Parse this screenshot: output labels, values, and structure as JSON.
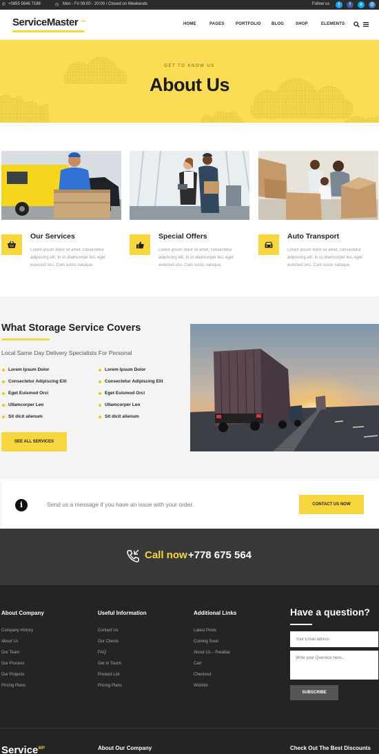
{
  "topbar": {
    "phone": "+0855 5646 7189",
    "hours": "Mon - Fri 08:00 - 20:00 / Closed on Weekends",
    "follow": "Follow us",
    "social": [
      {
        "icon": "twitter-icon",
        "glyph": "t",
        "color": "#1da1f2"
      },
      {
        "icon": "facebook-icon",
        "glyph": "f",
        "color": "#3b5998"
      },
      {
        "icon": "skype-icon",
        "glyph": "s",
        "color": "#00aff0"
      },
      {
        "icon": "email-icon",
        "glyph": "@",
        "color": "#2d7dd2"
      }
    ]
  },
  "header": {
    "logo": "ServiceMaster",
    "logo_sup": "WP",
    "nav": [
      "HOME",
      "PAGES",
      "PORTFOLIO",
      "BLOG",
      "SHOP",
      "ELEMENTS"
    ]
  },
  "hero": {
    "kicker": "GET TO KNOW US",
    "title": "About Us"
  },
  "cards": [
    {
      "title": "Our Services",
      "icon": "basket-icon",
      "text": "Lorem ipsum dolor sit amet, consectetur adipiscing elit. In ut ullamcorper leo, eget euismod orci. Cum sociis natoque."
    },
    {
      "title": "Special Offers",
      "icon": "thumbs-up-icon",
      "text": "Lorem ipsum dolor sit amet, consectetur adipiscing elit. In ut ullamcorper leo, eget euismod orci. Cum sociis natoque."
    },
    {
      "title": "Auto Transport",
      "icon": "car-icon",
      "text": "Lorem ipsum dolor sit amet, consectetur adipiscing elit. In ut ullamcorper leo, eget euismod orci. Cum sociis natoque."
    }
  ],
  "storage": {
    "title": "What Storage Service Covers",
    "subtitle": "Local Same Day Delivery Specialists For Personal",
    "list_left": [
      "Lorem Ipsum Dolor",
      "Consectetur Adipiscing Elit",
      "Eget Euismod Orci",
      "Ullamcorper Leo",
      "Sit dicit alienum"
    ],
    "list_right": [
      "Lorem Ipsum Dolor",
      "Consectetur Adipiscing Elit",
      "Eget Euismod Orci",
      "Ullamcorper Leo",
      "Sit dicit alienum"
    ],
    "button": "SEE ALL SERVICES"
  },
  "message": {
    "text": "Send us a message if you have an issue with your order.",
    "button": "CONTACT US NOW"
  },
  "call": {
    "label": "Call now",
    "number": "+778 675 564"
  },
  "footer": {
    "columns": [
      {
        "heading": "About Company",
        "links": [
          "Company History",
          "About Us",
          "Our Team",
          "Our Process",
          "Our Projects",
          "Pricing Plans"
        ]
      },
      {
        "heading": "Useful Information",
        "links": [
          "Contact Us",
          "Our Clients",
          "FAQ",
          "Get In Touch",
          "Product List",
          "Pricing Plans"
        ]
      },
      {
        "heading": "Additional Links",
        "links": [
          "Latest Posts",
          "Coming Soon",
          "About Us – Parallax",
          "Cart",
          "Checkout",
          "Wishlist"
        ]
      }
    ],
    "question": {
      "title": "Have a question?",
      "email_placeholder": "Your Email adress",
      "question_placeholder": "Write your Question here...",
      "button": "SUBSCRIBE"
    },
    "bottom_logo": "Service",
    "bottom_logo_sup": "WP",
    "bottom_h1": "About Our Company",
    "bottom_h2": "Check Out The Best Discounts"
  },
  "colors": {
    "accent": "#f7d63e",
    "dark": "#242424"
  }
}
